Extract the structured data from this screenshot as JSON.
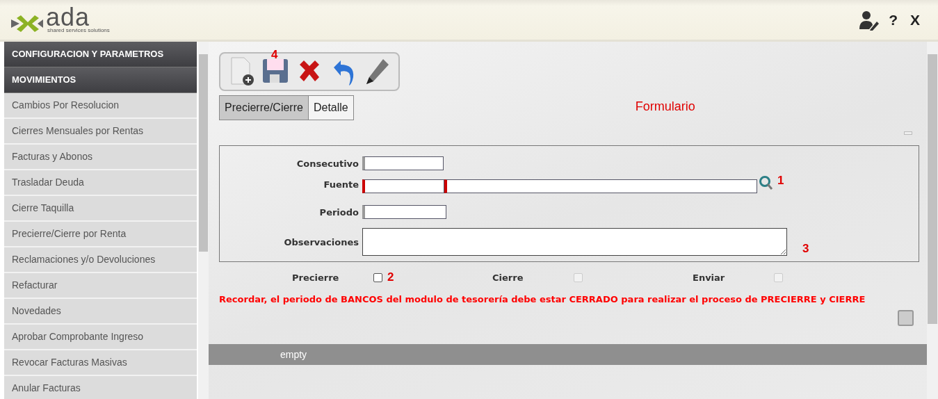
{
  "header": {
    "logo_text": "ada",
    "logo_tagline": "shared services solutions",
    "help": "?",
    "close": "X"
  },
  "sidebar": {
    "sections": [
      "CONFIGURACION Y PARAMETROS",
      "MOVIMIENTOS"
    ],
    "items": [
      "Cambios Por Resolucion",
      "Cierres Mensuales por Rentas",
      "Facturas y Abonos",
      "Trasladar Deuda",
      "Cierre Taquilla",
      "Precierre/Cierre por Renta",
      "Reclamaciones y/o Devoluciones",
      "Refacturar",
      "Novedades",
      "Aprobar Comprobante Ingreso",
      "Revocar Facturas Masivas",
      "Anular Facturas"
    ]
  },
  "toolbar": {
    "annotation": "4"
  },
  "tabs": [
    {
      "label": "Precierre/Cierre",
      "selected": true
    },
    {
      "label": "Detalle",
      "selected": false
    }
  ],
  "form_title": "Formulario",
  "fields": [
    {
      "kind": "text",
      "label": "Consecutivo",
      "required": false
    },
    {
      "kind": "lookup",
      "label": "Fuente",
      "required": true,
      "annotation": "1"
    },
    {
      "kind": "text",
      "label": "Periodo",
      "required": false
    },
    {
      "kind": "textarea",
      "label": "Observaciones",
      "annotation": "3"
    }
  ],
  "checks": [
    {
      "label": "Precierre",
      "checked": false,
      "disabled": false,
      "annotation": "2"
    },
    {
      "label": "Cierre",
      "checked": false,
      "disabled": true
    },
    {
      "label": "Enviar",
      "checked": false,
      "disabled": true
    }
  ],
  "warning": "Recordar, el periodo de BANCOS del modulo de tesorería debe estar CERRADO para realizar el proceso de PRECIERRE y CIERRE",
  "empty_label": "empty"
}
